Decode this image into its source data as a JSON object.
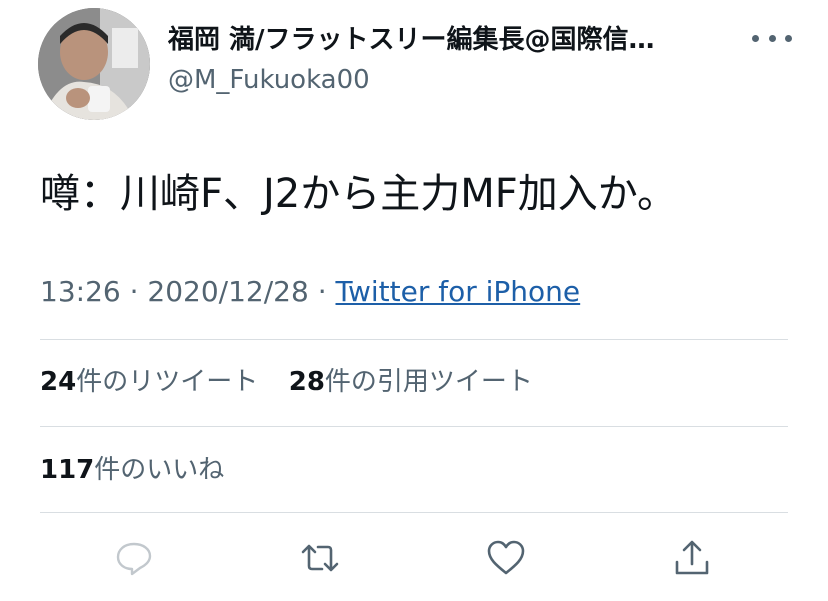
{
  "author": {
    "display_name": "福岡 満/フラットスリー編集長@国際信…",
    "handle": "@M_Fukuoka00"
  },
  "tweet": {
    "text": "噂：川崎F、J2から主力MF加入か。"
  },
  "meta": {
    "time": "13:26",
    "sep1": " · ",
    "date": "2020/12/28",
    "sep2": " · ",
    "source": "Twitter for iPhone"
  },
  "stats": {
    "retweets_count": "24",
    "retweets_label": "件のリツイート",
    "quotes_count": "28",
    "quotes_label": "件の引用ツイート",
    "likes_count": "117",
    "likes_label": "件のいいね"
  },
  "colors": {
    "text": "#0f1419",
    "secondary": "#536471",
    "link": "#1d5fa8",
    "divider": "#d9dee2"
  },
  "icons": {
    "reply": "reply-icon",
    "retweet": "retweet-icon",
    "like": "like-icon",
    "share": "share-icon",
    "more": "more-icon"
  }
}
